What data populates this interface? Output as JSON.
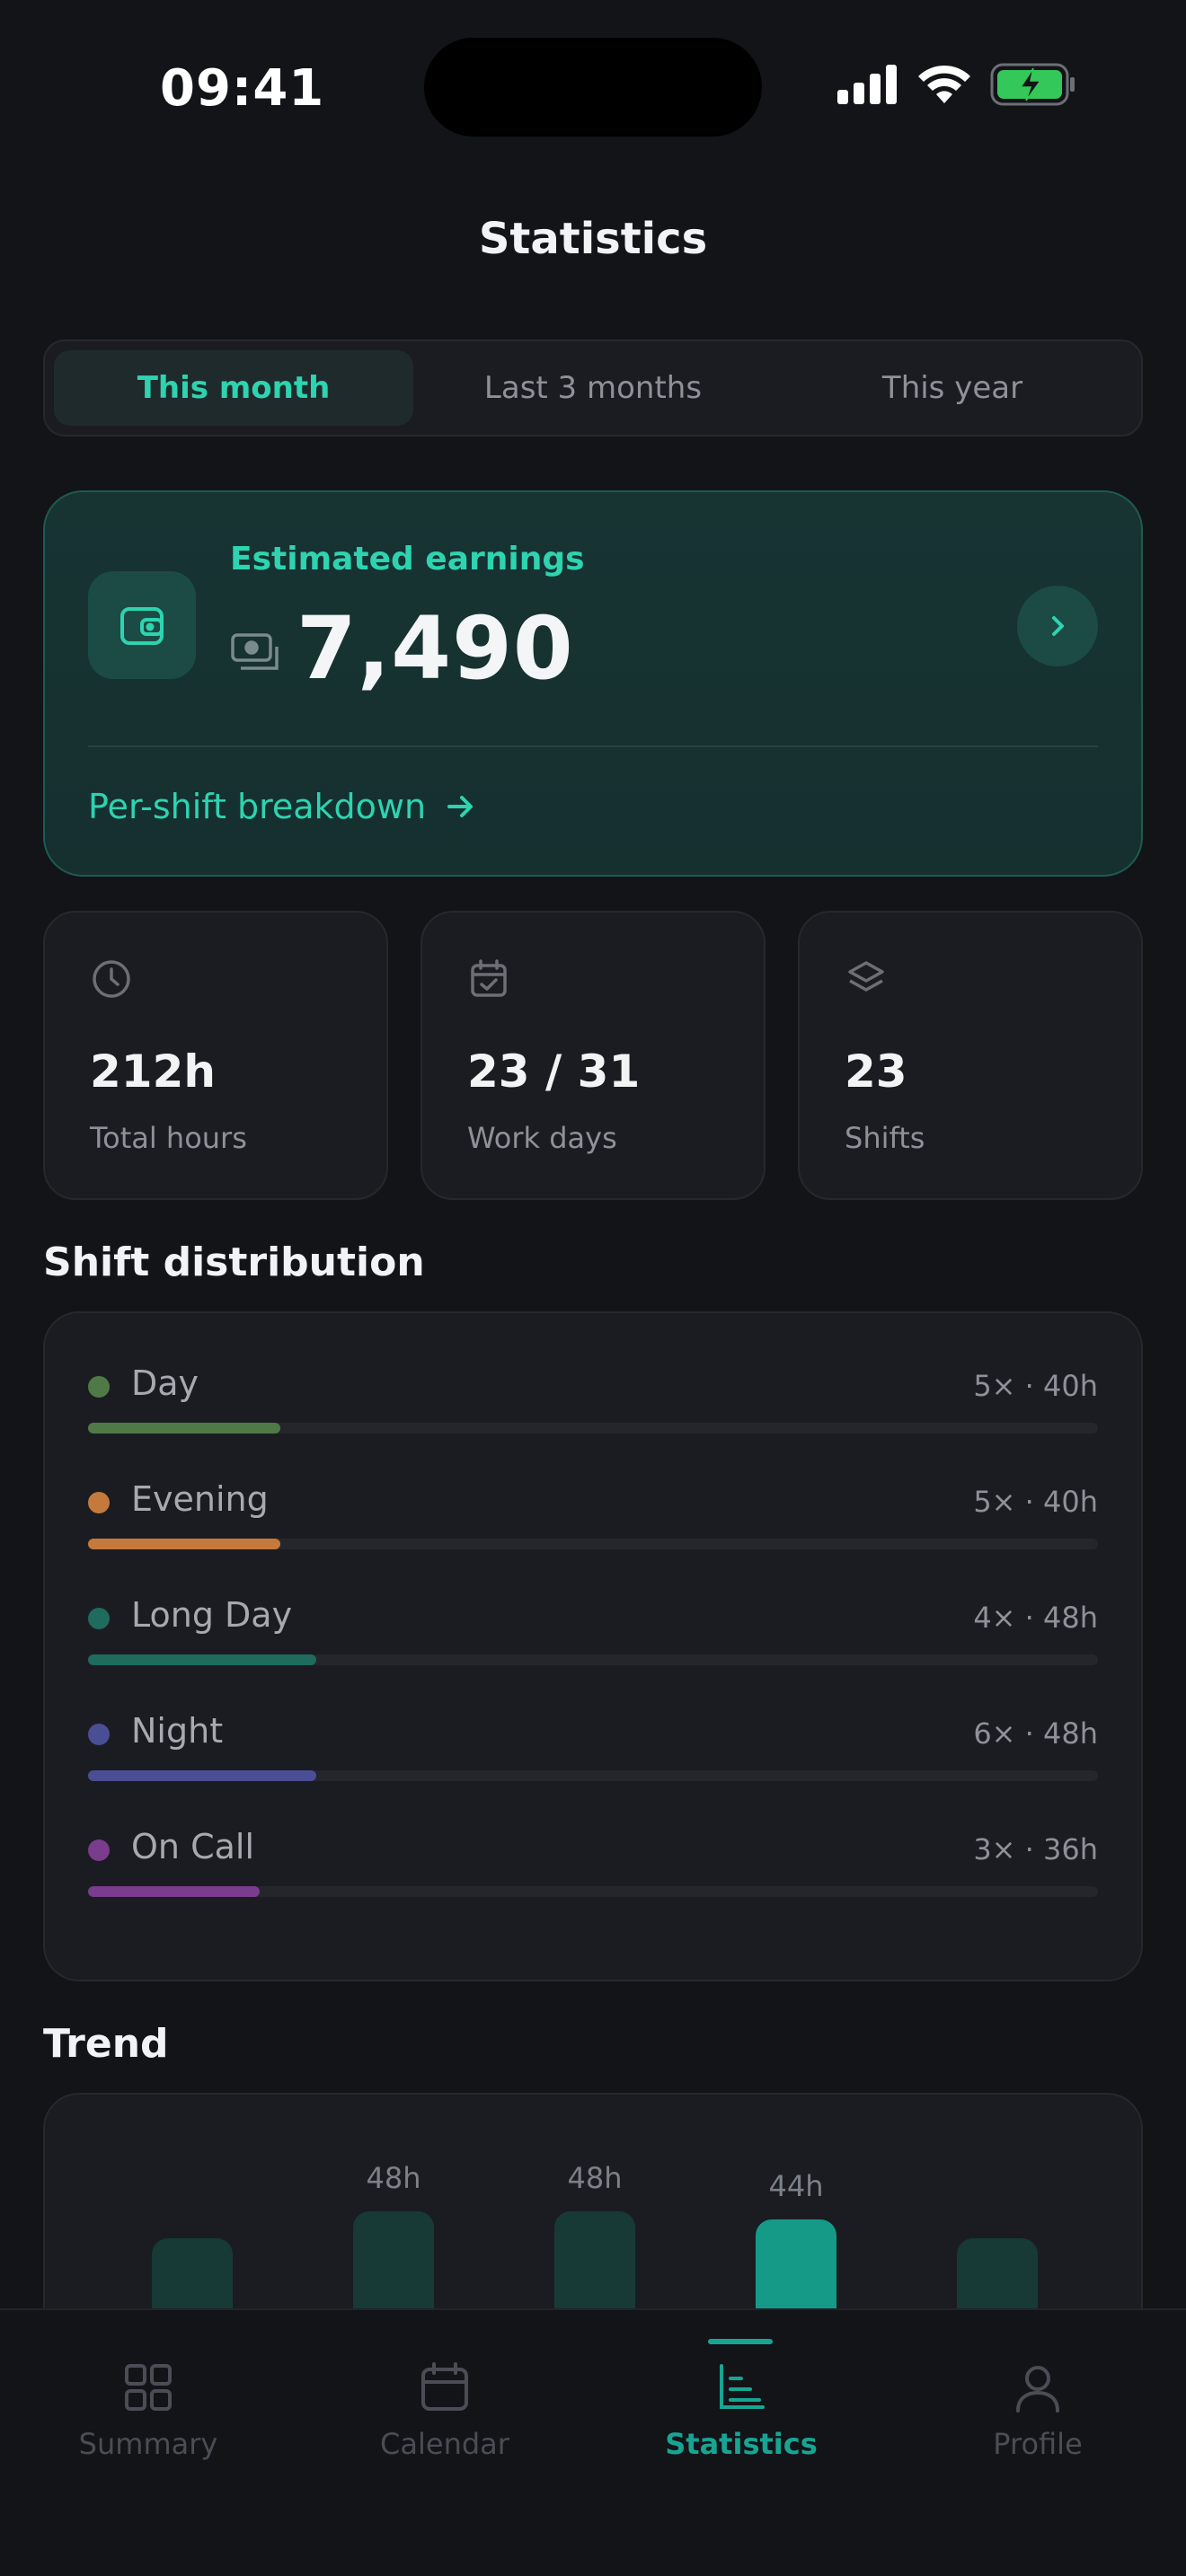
{
  "status_bar": {
    "time": "09:41"
  },
  "header": {
    "title": "Statistics"
  },
  "period_tabs": [
    {
      "label": "This month",
      "active": true
    },
    {
      "label": "Last 3 months",
      "active": false
    },
    {
      "label": "This year",
      "active": false
    }
  ],
  "earnings": {
    "label": "Estimated earnings",
    "value": "7,490",
    "link_label": "Per-shift breakdown",
    "accent_color": "#2ED3B0"
  },
  "stats": [
    {
      "icon": "clock-icon",
      "value": "212h",
      "label": "Total hours"
    },
    {
      "icon": "calendar-check-icon",
      "value": "23 / 31",
      "label": "Work days"
    },
    {
      "icon": "layers-icon",
      "value": "23",
      "label": "Shifts"
    }
  ],
  "distribution": {
    "title": "Shift distribution",
    "items": [
      {
        "name": "Day",
        "meta": "5× · 40h",
        "color": "#4F7A48",
        "fraction": 0.19
      },
      {
        "name": "Evening",
        "meta": "5× · 40h",
        "color": "#C47A3C",
        "fraction": 0.19
      },
      {
        "name": "Long Day",
        "meta": "4× · 48h",
        "color": "#1F6B5E",
        "fraction": 0.226
      },
      {
        "name": "Night",
        "meta": "6× · 48h",
        "color": "#4A4E94",
        "fraction": 0.226
      },
      {
        "name": "On Call",
        "meta": "3× · 36h",
        "color": "#7A3C8C",
        "fraction": 0.17
      }
    ]
  },
  "trend": {
    "title": "Trend",
    "bars": [
      {
        "label": "",
        "value": 35,
        "active": false
      },
      {
        "label": "48h",
        "value": 48,
        "active": false
      },
      {
        "label": "48h",
        "value": 48,
        "active": false
      },
      {
        "label": "44h",
        "value": 44,
        "active": true
      },
      {
        "label": "",
        "value": 35,
        "active": false
      }
    ]
  },
  "tabbar": [
    {
      "label": "Summary",
      "icon": "grid-icon",
      "active": false
    },
    {
      "label": "Calendar",
      "icon": "calendar-icon",
      "active": false
    },
    {
      "label": "Statistics",
      "icon": "chart-icon",
      "active": true
    },
    {
      "label": "Profile",
      "icon": "user-icon",
      "active": false
    }
  ]
}
